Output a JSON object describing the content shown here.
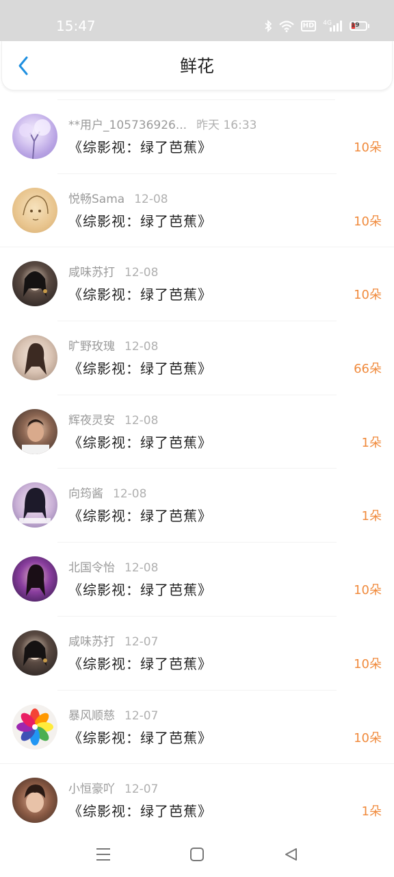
{
  "status_bar": {
    "time": "15:47",
    "network_label": "4G",
    "hd_label": "HD",
    "battery_level": "19",
    "icons": [
      "bluetooth-icon",
      "wifi-icon",
      "hd-icon",
      "signal-icon",
      "battery-icon"
    ]
  },
  "header": {
    "title": "鲜花",
    "back_icon": "chevron-left-icon",
    "accent": "#1e8fe0"
  },
  "colors": {
    "amount": "#f08a3c",
    "username": "#9a9a9a"
  },
  "list": [
    {
      "user": "**用户_105736926...",
      "date": "昨天 16:33",
      "book": "《综影视：绿了芭蕉》",
      "amount": "10朵"
    },
    {
      "user": "悦畅Sama",
      "date": "12-08",
      "book": "《综影视：绿了芭蕉》",
      "amount": "10朵"
    },
    {
      "user": "咸味苏打",
      "date": "12-08",
      "book": "《综影视：绿了芭蕉》",
      "amount": "10朵"
    },
    {
      "user": "旷野玫瑰",
      "date": "12-08",
      "book": "《综影视：绿了芭蕉》",
      "amount": "66朵"
    },
    {
      "user": "辉夜灵安",
      "date": "12-08",
      "book": "《综影视：绿了芭蕉》",
      "amount": "1朵"
    },
    {
      "user": "向筠酱",
      "date": "12-08",
      "book": "《综影视：绿了芭蕉》",
      "amount": "1朵"
    },
    {
      "user": "北国令怡",
      "date": "12-08",
      "book": "《综影视：绿了芭蕉》",
      "amount": "10朵"
    },
    {
      "user": "咸味苏打",
      "date": "12-07",
      "book": "《综影视：绿了芭蕉》",
      "amount": "10朵"
    },
    {
      "user": "暴风顺慈",
      "date": "12-07",
      "book": "《综影视：绿了芭蕉》",
      "amount": "10朵"
    },
    {
      "user": "小恒豪吖",
      "date": "12-07",
      "book": "《综影视：绿了芭蕉》",
      "amount": "1朵"
    }
  ],
  "nav_bar": {
    "icons": [
      "menu-icon",
      "home-icon",
      "back-triangle-icon"
    ]
  }
}
